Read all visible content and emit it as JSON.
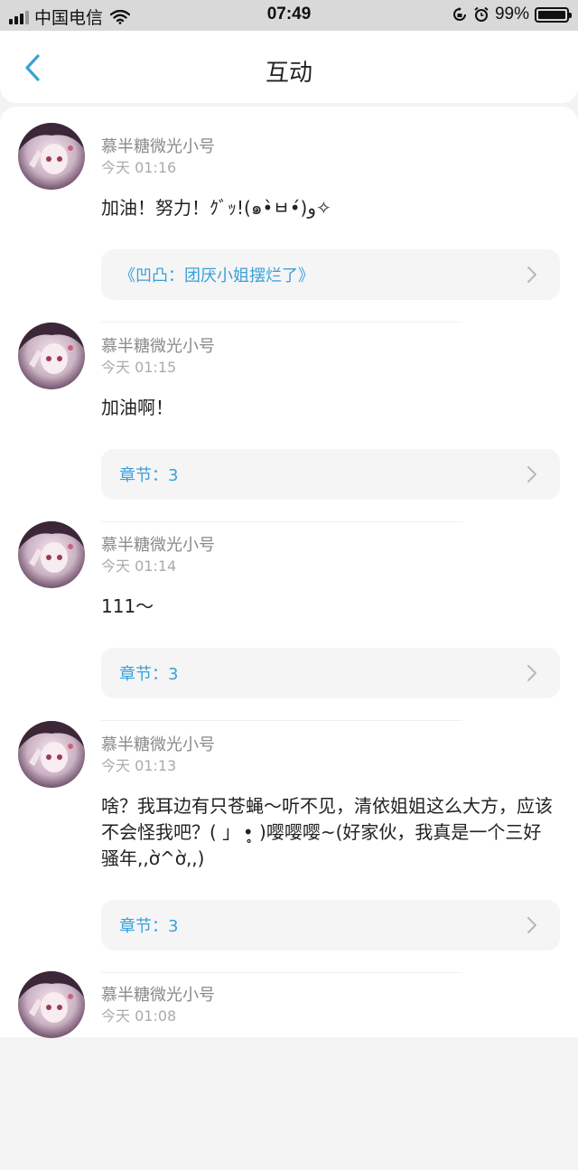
{
  "status_bar": {
    "carrier": "中国电信",
    "time": "07:49",
    "battery_text": "99%",
    "battery_level": 0.99
  },
  "header": {
    "title": "互动"
  },
  "posts": [
    {
      "user": "慕半糖微光小号",
      "time": "今天 01:16",
      "content": "加油！努力！ｸﾞｯ!(๑•̀ㅂ•́)و✧",
      "link": "《凹凸：团厌小姐摆烂了》"
    },
    {
      "user": "慕半糖微光小号",
      "time": "今天 01:15",
      "content": "加油啊！",
      "link": "章节：3"
    },
    {
      "user": "慕半糖微光小号",
      "time": "今天 01:14",
      "content": "111～",
      "link": "章节：3"
    },
    {
      "user": "慕半糖微光小号",
      "time": "今天 01:13",
      "content": "啥？我耳边有只苍蝇～听不见，清依姐姐这么大方，应该不会怪我吧？( ｣ ­ •̥ )嘤嘤嘤~(好家伙，我真是一个三好骚年,,ờ^ờ,,)",
      "link": "章节：3"
    },
    {
      "user": "慕半糖微光小号",
      "time": "今天 01:08"
    }
  ],
  "colors": {
    "accent": "#3aa0d8",
    "status_bar_bg": "#d9d9d9",
    "page_bg": "#f3f3f4"
  },
  "icons": [
    "signal-icon",
    "wifi-icon",
    "lock-rotation-icon",
    "alarm-icon",
    "battery-icon",
    "back-chevron-icon",
    "chevron-right-icon",
    "avatar"
  ]
}
